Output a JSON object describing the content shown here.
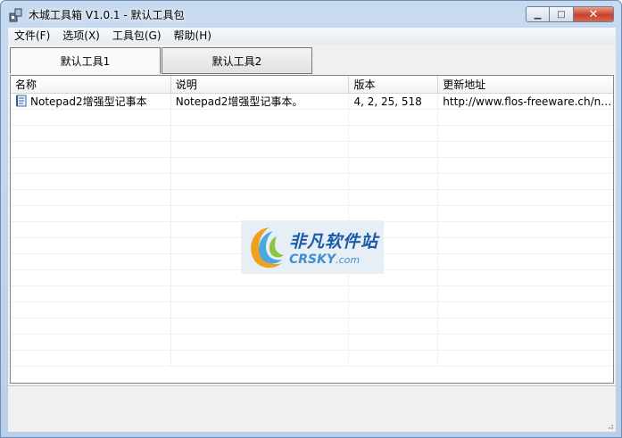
{
  "window": {
    "title": "木城工具箱 V1.0.1 - 默认工具包",
    "controls": {
      "minimize": "▁",
      "maximize": "□",
      "close": "✕"
    }
  },
  "menubar": {
    "items": [
      {
        "label": "文件(F)"
      },
      {
        "label": "选项(X)"
      },
      {
        "label": "工具包(G)"
      },
      {
        "label": "帮助(H)"
      }
    ]
  },
  "tabs": [
    {
      "label": "默认工具1",
      "active": true
    },
    {
      "label": "默认工具2",
      "active": false
    }
  ],
  "list": {
    "columns": [
      "名称",
      "说明",
      "版本",
      "更新地址"
    ],
    "rows": [
      {
        "name": "Notepad2增强型记事本",
        "desc": "Notepad2增强型记事本。",
        "version": "4, 2, 25, 518",
        "url": "http://www.flos-freeware.ch/no..."
      }
    ],
    "empty_rows": 16
  },
  "watermark": {
    "cn": "非凡软件站",
    "en": "CRSKY",
    "domain": ".com"
  },
  "colors": {
    "accent": "#1a5aa8",
    "close": "#c8402a"
  }
}
